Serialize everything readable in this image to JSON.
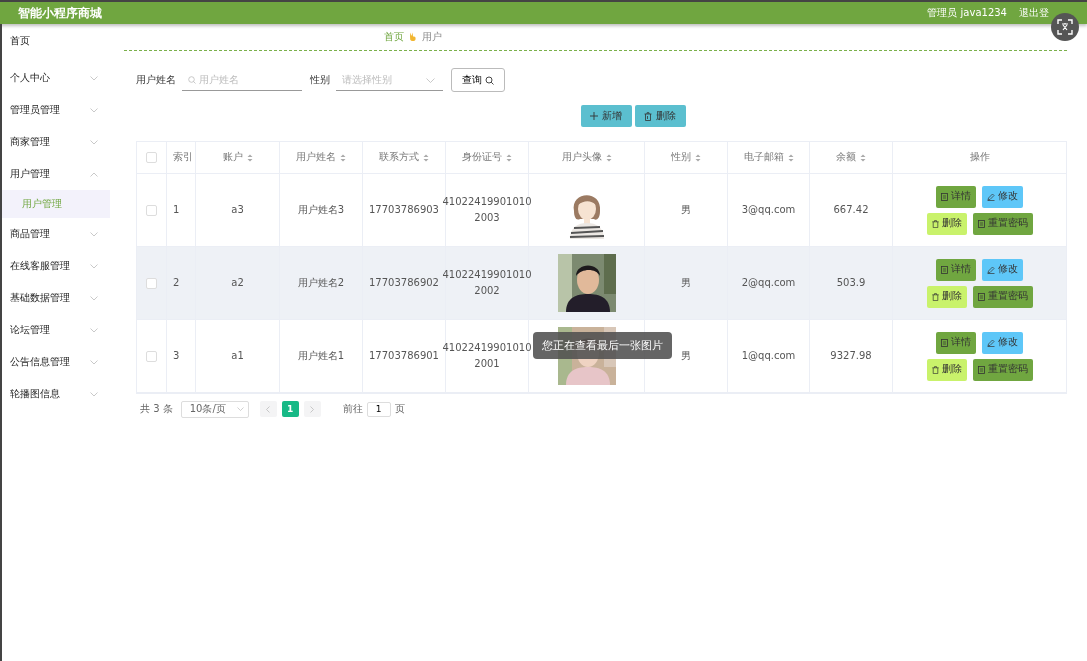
{
  "header": {
    "title": "智能小程序商城",
    "user": "管理员 java1234",
    "logout": "退出登"
  },
  "sidebar": {
    "items": [
      {
        "label": "首页",
        "kind": "link"
      },
      {
        "label": "个人中心",
        "kind": "menu",
        "expanded": false
      },
      {
        "label": "管理员管理",
        "kind": "menu",
        "expanded": false
      },
      {
        "label": "商家管理",
        "kind": "menu",
        "expanded": false
      },
      {
        "label": "用户管理",
        "kind": "menu",
        "expanded": true,
        "children": [
          {
            "label": "用户管理",
            "selected": true
          }
        ]
      },
      {
        "label": "商品管理",
        "kind": "menu",
        "expanded": false
      },
      {
        "label": "在线客服管理",
        "kind": "menu",
        "expanded": false
      },
      {
        "label": "基础数据管理",
        "kind": "menu",
        "expanded": false
      },
      {
        "label": "论坛管理",
        "kind": "menu",
        "expanded": false
      },
      {
        "label": "公告信息管理",
        "kind": "menu",
        "expanded": false
      },
      {
        "label": "轮播图信息",
        "kind": "menu",
        "expanded": false
      }
    ]
  },
  "breadcrumb": [
    "首页",
    "用户"
  ],
  "search": {
    "fields": [
      {
        "label": "用户姓名",
        "placeholder": "用户姓名",
        "kind": "text"
      },
      {
        "label": "性别",
        "placeholder": "请选择性别",
        "kind": "select"
      }
    ],
    "button": "查询"
  },
  "actions": [
    {
      "label": "新增",
      "kind": "add"
    },
    {
      "label": "删除",
      "kind": "delete"
    }
  ],
  "table": {
    "select_all_checked": false,
    "columns": [
      {
        "label": "索引",
        "sortable": false
      },
      {
        "label": "账户",
        "sortable": true
      },
      {
        "label": "用户姓名",
        "sortable": true
      },
      {
        "label": "联系方式",
        "sortable": true
      },
      {
        "label": "身份证号",
        "sortable": true
      },
      {
        "label": "用户头像",
        "sortable": true
      },
      {
        "label": "性别",
        "sortable": true
      },
      {
        "label": "电子邮箱",
        "sortable": true
      },
      {
        "label": "余额",
        "sortable": true
      },
      {
        "label": "操作",
        "sortable": false
      }
    ],
    "rows": [
      {
        "checked": false,
        "highlighted": false,
        "index": "1",
        "account": "a3",
        "name": "用户姓名3",
        "phone": "17703786903",
        "id_card": [
          "41022419901010",
          "2003"
        ],
        "avatar": {
          "kind": "picture"
        },
        "gender": "男",
        "email": "3@qq.com",
        "balance": "667.42",
        "actions": [
          {
            "label": "详情",
            "kind": "detail"
          },
          {
            "label": "修改",
            "kind": "edit"
          },
          {
            "label": "删除",
            "kind": "delete"
          },
          {
            "label": "重置密码",
            "kind": "reset"
          }
        ]
      },
      {
        "checked": false,
        "highlighted": true,
        "index": "2",
        "account": "a2",
        "name": "用户姓名2",
        "phone": "17703786902",
        "id_card": [
          "41022419901010",
          "2002"
        ],
        "avatar": {
          "kind": "picture"
        },
        "gender": "男",
        "email": "2@qq.com",
        "balance": "503.9",
        "actions": [
          {
            "label": "详情",
            "kind": "detail"
          },
          {
            "label": "修改",
            "kind": "edit"
          },
          {
            "label": "删除",
            "kind": "delete"
          },
          {
            "label": "重置密码",
            "kind": "reset"
          }
        ]
      },
      {
        "checked": false,
        "highlighted": false,
        "index": "3",
        "account": "a1",
        "name": "用户姓名1",
        "phone": "17703786901",
        "id_card": [
          "41022419901010",
          "2001"
        ],
        "avatar": {
          "kind": "picture"
        },
        "gender": "男",
        "email": "1@qq.com",
        "balance": "9327.98",
        "actions": [
          {
            "label": "详情",
            "kind": "detail"
          },
          {
            "label": "修改",
            "kind": "edit"
          },
          {
            "label": "删除",
            "kind": "delete"
          },
          {
            "label": "重置密码",
            "kind": "reset"
          }
        ]
      }
    ]
  },
  "pagination": {
    "total": "共 3 条",
    "page_size": "10条/页",
    "pages": [
      {
        "label": "1",
        "selected": true
      }
    ],
    "goto_label": "前往",
    "goto_value": "1",
    "goto_suffix": "页"
  },
  "toast": "您正在查看最后一张图片"
}
